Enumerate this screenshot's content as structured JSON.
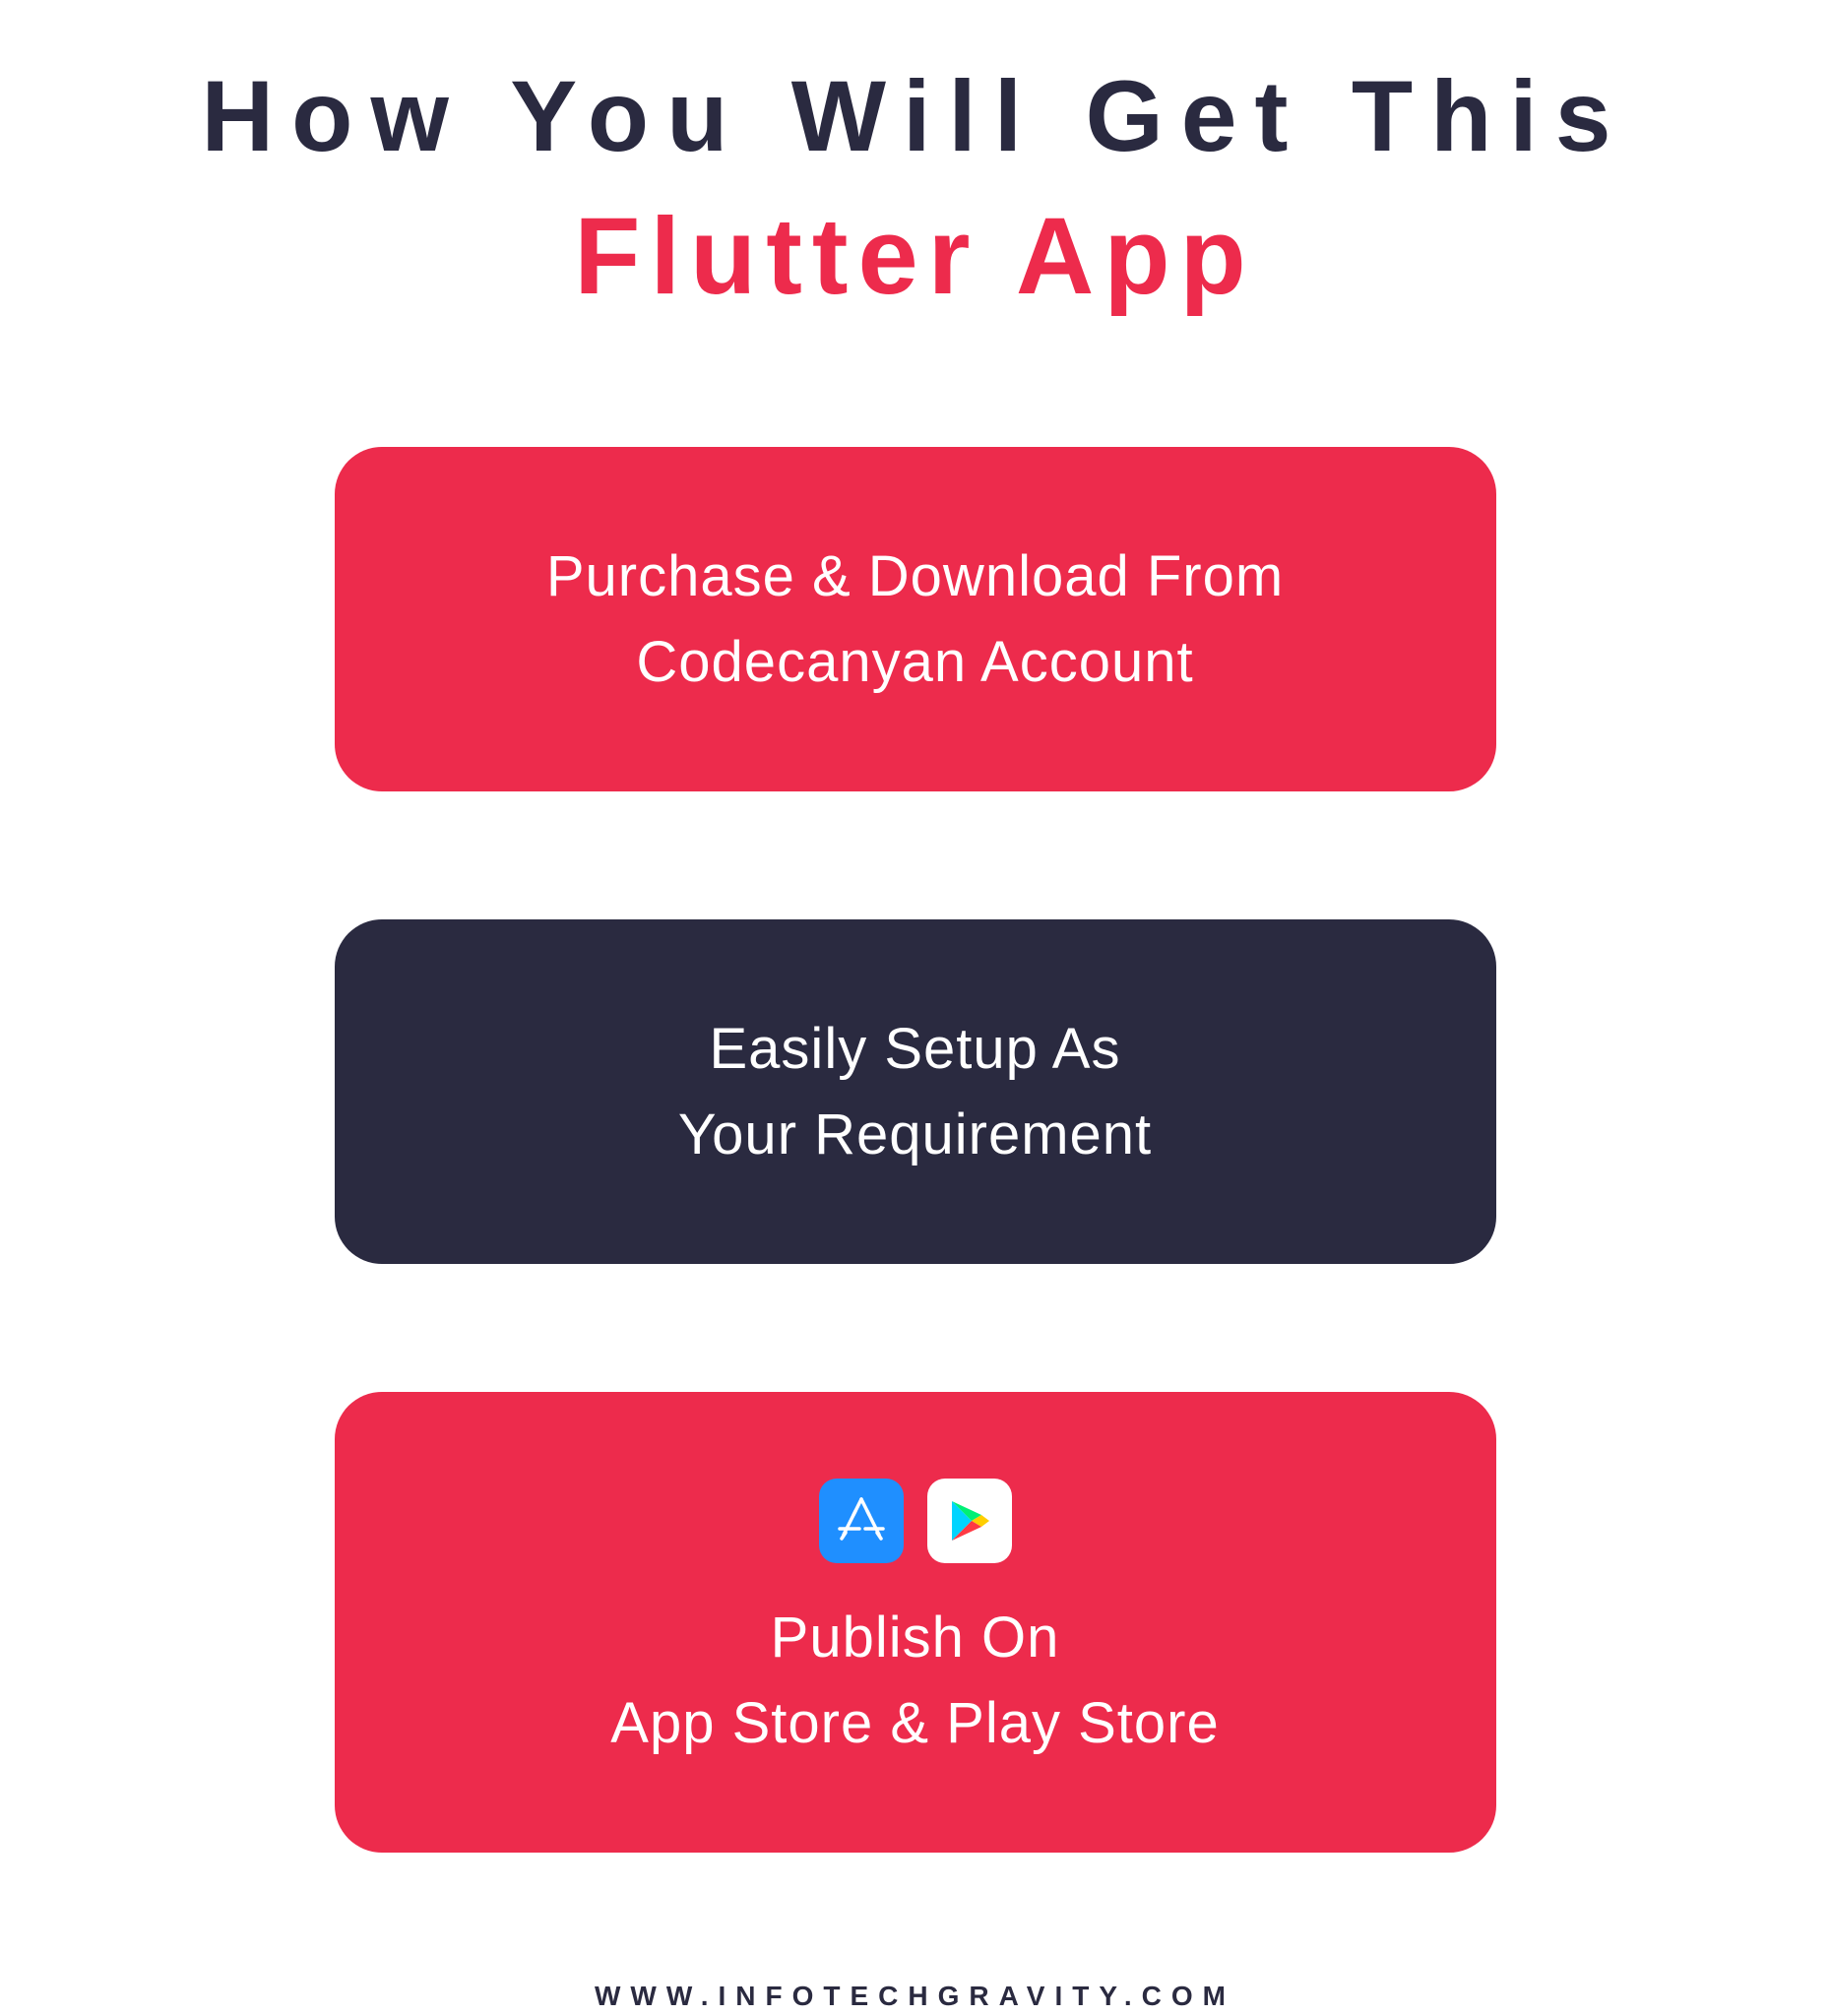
{
  "heading": {
    "line1": "How You Will Get This",
    "line2": "Flutter App"
  },
  "cards": {
    "purchase": {
      "line1": "Purchase & Download From",
      "line2": "Codecanyan Account"
    },
    "setup": {
      "line1": "Easily Setup As",
      "line2": "Your Requirement"
    },
    "publish": {
      "line1": "Publish On",
      "line2": "App Store & Play Store"
    }
  },
  "icons": {
    "app_store": "app-store-icon",
    "play_store": "play-store-icon"
  },
  "footer": "WWW.INFOTECHGRAVITY.COM",
  "colors": {
    "accent_red": "#ed2b4c",
    "dark_navy": "#2a2a40",
    "white": "#ffffff",
    "apple_blue": "#1f8fff"
  }
}
